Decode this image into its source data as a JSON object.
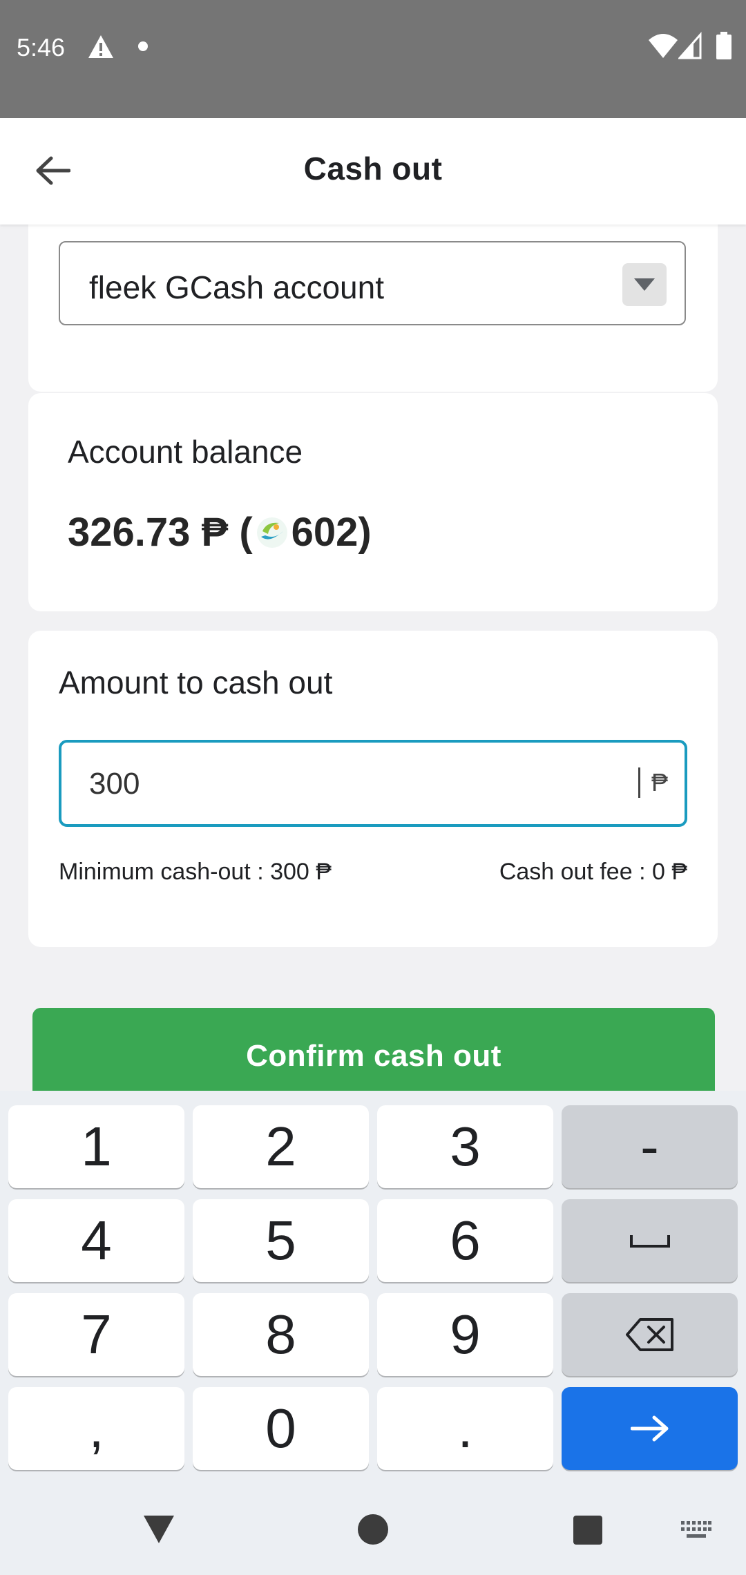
{
  "status_bar": {
    "time": "5:46"
  },
  "app_bar": {
    "title": "Cash out"
  },
  "account_select": {
    "value": "fleek GCash account"
  },
  "balance": {
    "label": "Account balance",
    "amount": "326.73 ₱ (",
    "coins": "602)"
  },
  "amount_card": {
    "label": "Amount to cash out",
    "input_value": "300",
    "currency": "₱",
    "minimum": "Minimum cash-out : 300 ₱",
    "fee": "Cash out fee : 0 ₱"
  },
  "confirm_button": {
    "label": "Confirm cash out"
  },
  "keyboard": {
    "keys": [
      "1",
      "2",
      "3",
      "-",
      "4",
      "5",
      "6",
      "␣",
      "7",
      "8",
      "9",
      "⌫",
      ",",
      "0",
      ".",
      "→"
    ]
  },
  "colors": {
    "accent_teal": "#1a9bbf",
    "confirm_green": "#3aa853",
    "enter_blue": "#1a73e8"
  }
}
